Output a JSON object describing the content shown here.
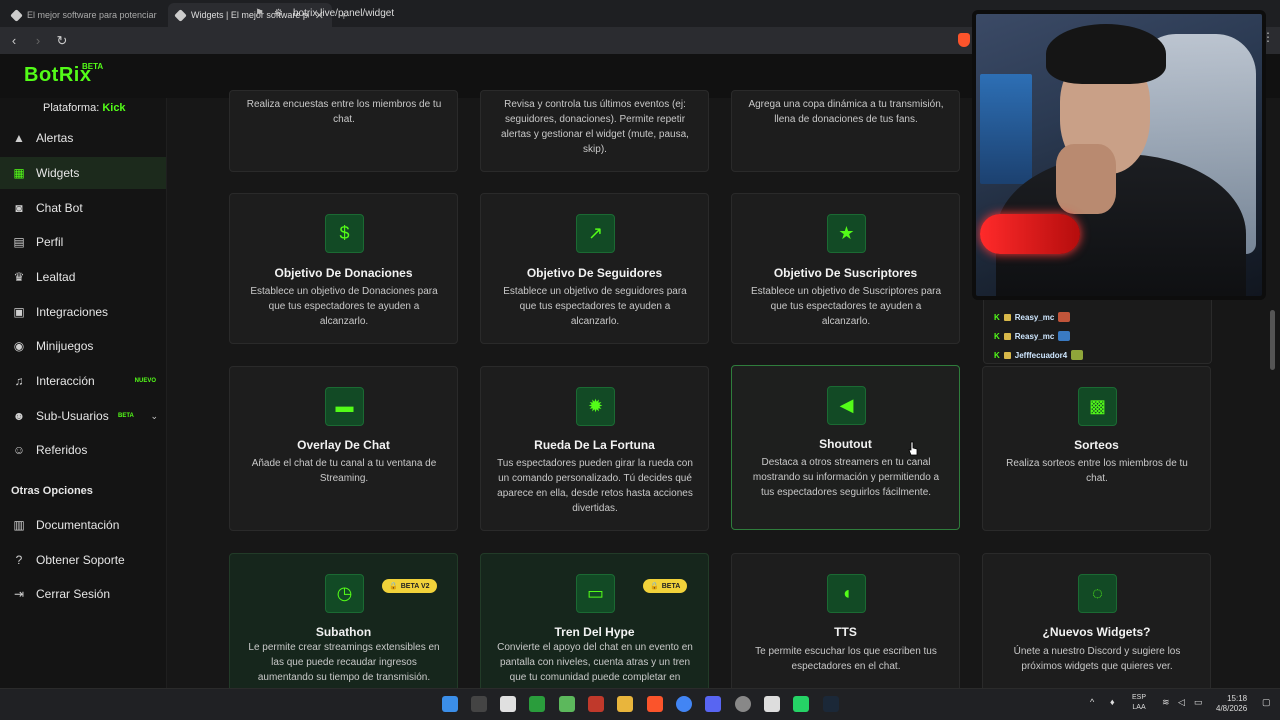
{
  "browser": {
    "tabs": [
      {
        "title": "El mejor software para potenciar",
        "active": false
      },
      {
        "title": "Widgets | El mejor software para",
        "active": true
      }
    ],
    "url": "botrix.live/panel/widget"
  },
  "app": {
    "logo": "BotRix",
    "logo_badge": "BETA",
    "platform_label": "Plataforma:",
    "platform_value": "Kick",
    "accent": "#53fc18"
  },
  "sidebar": {
    "items": [
      {
        "label": "Alertas",
        "icon": "warning-icon"
      },
      {
        "label": "Widgets",
        "icon": "grid-icon",
        "active": true
      },
      {
        "label": "Chat Bot",
        "icon": "robot-icon"
      },
      {
        "label": "Perfil",
        "icon": "id-card-icon"
      },
      {
        "label": "Lealtad",
        "icon": "trophy-icon"
      },
      {
        "label": "Integraciones",
        "icon": "plug-icon"
      },
      {
        "label": "Minijuegos",
        "icon": "gamepad-icon"
      },
      {
        "label": "Interacción",
        "icon": "music-icon",
        "badge": "NUEVO"
      },
      {
        "label": "Sub-Usuarios",
        "icon": "users-icon",
        "badge": "BETA"
      },
      {
        "label": "Referidos",
        "icon": "referral-icon"
      }
    ],
    "section_title": "Otras Opciones",
    "other_items": [
      {
        "label": "Documentación",
        "icon": "book-icon"
      },
      {
        "label": "Obtener Soporte",
        "icon": "help-icon"
      },
      {
        "label": "Cerrar Sesión",
        "icon": "logout-icon"
      }
    ]
  },
  "widgets": {
    "row0": [
      {
        "desc": "Realiza encuestas entre los miembros de tu chat."
      },
      {
        "desc": "Revisa y controla tus últimos eventos (ej: seguidores, donaciones). Permite repetir alertas y gestionar el widget (mute, pausa, skip)."
      },
      {
        "desc": "Agrega una copa dinámica a tu transmisión, llena de donaciones de tus fans."
      }
    ],
    "row1": [
      {
        "title": "Objetivo De Donaciones",
        "desc": "Establece un objetivo de Donaciones para que tus espectadores te ayuden a alcanzarlo.",
        "icon": "dollar-icon"
      },
      {
        "title": "Objetivo De Seguidores",
        "desc": "Establece un objetivo de seguidores para que tus espectadores te ayuden a alcanzarlo.",
        "icon": "chart-icon"
      },
      {
        "title": "Objetivo De Suscriptores",
        "desc": "Establece un objetivo de Suscriptores para que tus espectadores te ayuden a alcanzarlo.",
        "icon": "star-icon"
      }
    ],
    "row2": [
      {
        "title": "Overlay De Chat",
        "desc": "Añade el chat de tu canal a tu ventana de Streaming.",
        "icon": "chat-icon"
      },
      {
        "title": "Rueda De La Fortuna",
        "desc": "Tus espectadores pueden girar la rueda con un comando personalizado. Tú decides qué aparece en ella, desde retos hasta acciones divertidas.",
        "icon": "wheel-icon"
      },
      {
        "title": "Shoutout",
        "desc": "Destaca a otros streamers en tu canal mostrando su información y permitiendo a tus espectadores seguirlos fácilmente.",
        "icon": "megaphone-icon"
      },
      {
        "title": "Sorteos",
        "desc": "Realiza sorteos entre los miembros de tu chat.",
        "icon": "gift-icon"
      }
    ],
    "row3": [
      {
        "title": "Subathon",
        "desc": "Le permite crear streamings extensibles en las que puede recaudar ingresos aumentando su tiempo de transmisión.",
        "icon": "clock-icon",
        "badge": "BETA V2"
      },
      {
        "title": "Tren Del Hype",
        "desc": "Convierte el apoyo del chat en un evento en pantalla con niveles, cuenta atras y un tren que tu comunidad puede completar en",
        "icon": "train-icon",
        "badge": "BETA"
      },
      {
        "title": "TTS",
        "desc": "Te permite escuchar los que escriben tus espectadores en el chat.",
        "icon": "speaker-icon"
      },
      {
        "title": "¿Nuevos Widgets?",
        "desc": "Únete a nuestro Discord y sugiere los próximos widgets que quieres ver.",
        "icon": "bulb-icon"
      }
    ]
  },
  "chat_preview": {
    "lines": [
      "Reasy_mc",
      "Reasy_mc",
      "Jefffecuador4"
    ]
  },
  "taskbar": {
    "lang": "ESP",
    "lang2": "LAA",
    "time": "15:18",
    "date": "4/8/2026"
  }
}
